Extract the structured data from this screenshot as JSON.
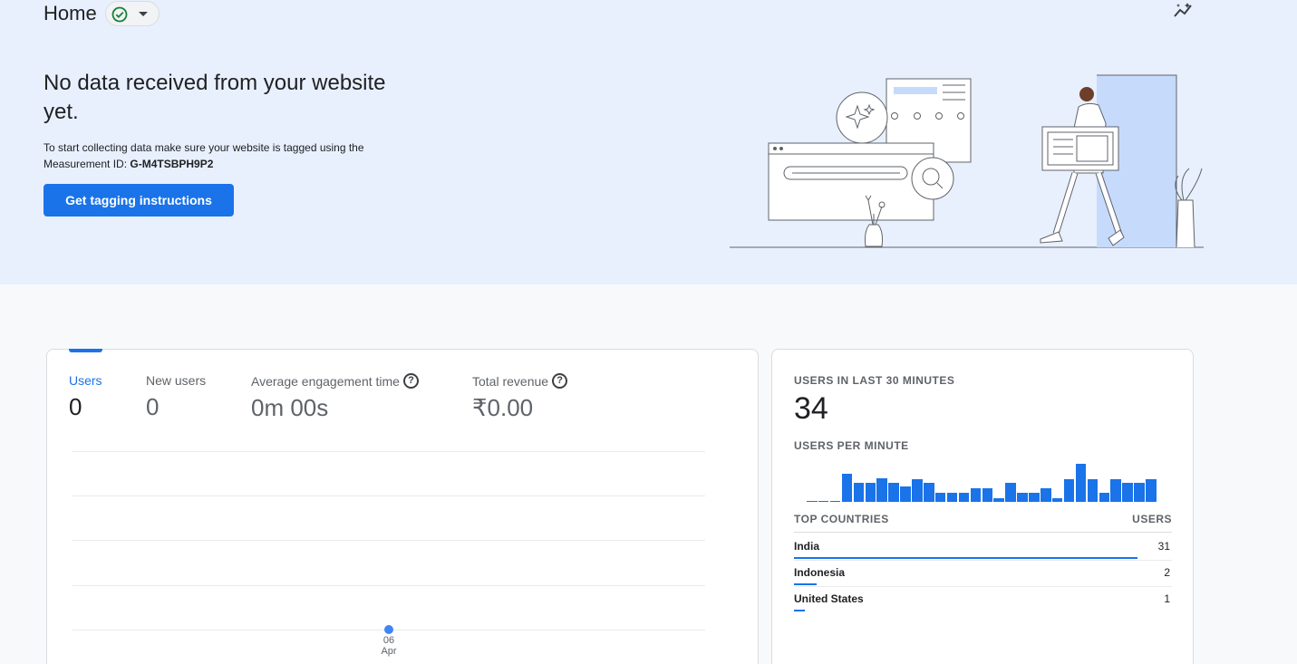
{
  "header": {
    "title": "Home",
    "status": "check-circle-icon"
  },
  "banner": {
    "headline": "No data received from your website yet.",
    "instruction_prefix": "To start collecting data make sure your website is tagged using the Measurement ID: ",
    "measurement_id": "G-M4TSBPH9P2",
    "button_label": "Get tagging instructions"
  },
  "metrics": [
    {
      "label": "Users",
      "value": "0"
    },
    {
      "label": "New users",
      "value": "0"
    },
    {
      "label": "Average engagement time",
      "value": "0m 00s"
    },
    {
      "label": "Total revenue",
      "value": "₹0.00"
    }
  ],
  "chart_data": {
    "type": "line",
    "x": [
      "06 Apr"
    ],
    "series": [
      {
        "values": [
          0
        ]
      }
    ],
    "tick_labels": {
      "day": "06",
      "month": "Apr"
    }
  },
  "realtime": {
    "users_label": "USERS IN LAST 30 MINUTES",
    "users_value": "34",
    "per_minute_label": "USERS PER MINUTE",
    "per_minute": [
      0,
      0,
      0,
      3,
      2,
      2,
      2.5,
      2,
      1.6,
      2.4,
      2,
      1,
      1,
      1,
      1.4,
      1.4,
      0.4,
      2,
      1,
      1,
      1.4,
      0.4,
      2.4,
      4,
      2.4,
      1,
      2.4,
      2,
      2,
      2.4
    ],
    "countries_label": "TOP COUNTRIES",
    "users_col_label": "USERS",
    "countries": [
      {
        "name": "India",
        "users": "31",
        "share": 1.0
      },
      {
        "name": "Indonesia",
        "users": "2",
        "share": 0.065
      },
      {
        "name": "United States",
        "users": "1",
        "share": 0.032
      }
    ]
  },
  "colors": {
    "accent": "#1a73e8",
    "banner_bg": "#e8f0fe",
    "success": "#188038"
  }
}
